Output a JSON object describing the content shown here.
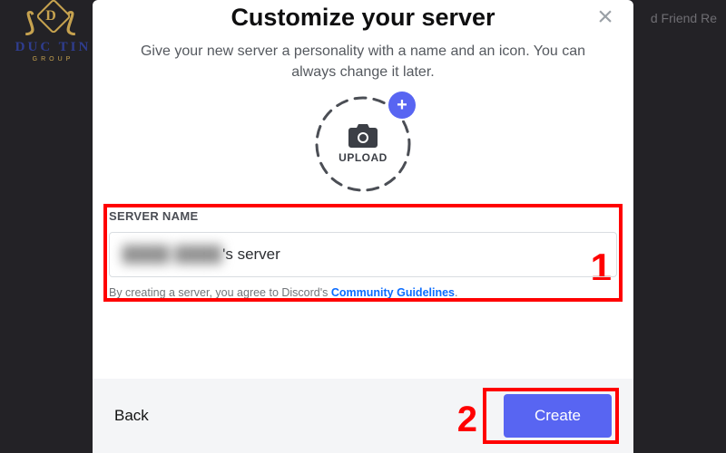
{
  "logo": {
    "brand": "DUC TIN",
    "sub": "GROUP",
    "monogram": "D"
  },
  "background": {
    "partial_text": "d Friend Re"
  },
  "modal": {
    "title": "Customize your server",
    "subtitle": "Give your new server a personality with a name and an icon. You can always change it later.",
    "close_label": "×",
    "upload": {
      "label": "UPLOAD",
      "plus": "+"
    },
    "server_name": {
      "label": "SERVER NAME",
      "value_hidden": "████ ████",
      "value_suffix": "'s server"
    },
    "agreement": {
      "prefix": "By creating a server, you agree to Discord's ",
      "link": "Community Guidelines",
      "suffix": "."
    },
    "footer": {
      "back": "Back",
      "create": "Create"
    }
  },
  "annotations": {
    "one": "1",
    "two": "2"
  },
  "colors": {
    "accent": "#5865f2",
    "annotation": "#ff0000",
    "link": "#0a6cff"
  }
}
